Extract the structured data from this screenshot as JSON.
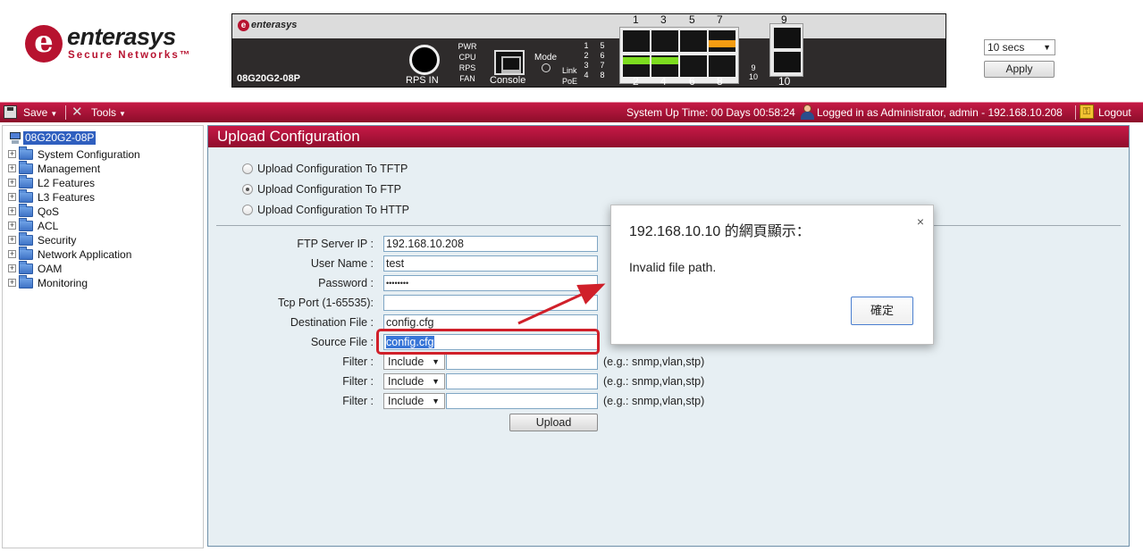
{
  "header": {
    "logo_word": "enterasys",
    "logo_sub": "Secure Networks™",
    "logo_mark": "e",
    "device_brand": "enterasys",
    "device_model": "08G20G2-08P",
    "rps_label": "RPS IN",
    "console_label": "Console",
    "mode_label": "Mode",
    "status_leds": [
      "PWR",
      "CPU",
      "RPS",
      "FAN"
    ],
    "link_label": "Link",
    "poe_label": "PoE",
    "led_numbers_left": [
      "1",
      "2",
      "3",
      "4"
    ],
    "led_numbers_right": [
      "5",
      "6",
      "7",
      "8"
    ],
    "led_extra_9": "9",
    "led_extra_10": "10",
    "port_numbers_top": [
      "1",
      "3",
      "5",
      "7"
    ],
    "port_numbers_bottom": [
      "2",
      "4",
      "6",
      "8"
    ],
    "sfp_top": "9",
    "sfp_bottom": "10",
    "refresh_value": "10 secs",
    "apply_label": "Apply"
  },
  "toolbar": {
    "save_label": "Save",
    "tools_label": "Tools",
    "uptime": "System Up Time: 00 Days 00:58:24",
    "login_info": "Logged in as Administrator, admin - 192.168.10.208",
    "logout_label": "Logout"
  },
  "tree": {
    "root": "08G20G2-08P",
    "items": [
      "System Configuration",
      "Management",
      "L2 Features",
      "L3 Features",
      "QoS",
      "ACL",
      "Security",
      "Network Application",
      "OAM",
      "Monitoring"
    ]
  },
  "panel": {
    "title": "Upload Configuration",
    "radios": [
      {
        "label": "Upload Configuration To TFTP",
        "checked": false
      },
      {
        "label": "Upload Configuration To FTP",
        "checked": true
      },
      {
        "label": "Upload Configuration To HTTP",
        "checked": false
      }
    ],
    "form": {
      "ftp_ip_label": "FTP Server IP :",
      "ftp_ip_value": "192.168.10.208",
      "user_label": "User Name :",
      "user_value": "test",
      "password_label": "Password :",
      "password_value": "••••••••",
      "port_label": "Tcp Port (1-65535):",
      "port_value": "",
      "dest_label": "Destination File :",
      "dest_value": "config.cfg",
      "source_label": "Source File :",
      "source_value": "config.cfg",
      "filter_label": "Filter :",
      "filter_option": "Include",
      "filter_hint": "(e.g.: snmp,vlan,stp)",
      "upload_label": "Upload"
    }
  },
  "dialog": {
    "title": "192.168.10.10 的網頁顯示：",
    "message": "Invalid file path.",
    "ok_label": "確定",
    "close_symbol": "×"
  },
  "colors": {
    "brand_red": "#b7122f",
    "toolbar_red": "#c51a45",
    "panel_bg": "#e7eff3",
    "highlight_red": "#d0202a",
    "port_green": "#7ddc1f",
    "port_orange": "#f39c12"
  }
}
